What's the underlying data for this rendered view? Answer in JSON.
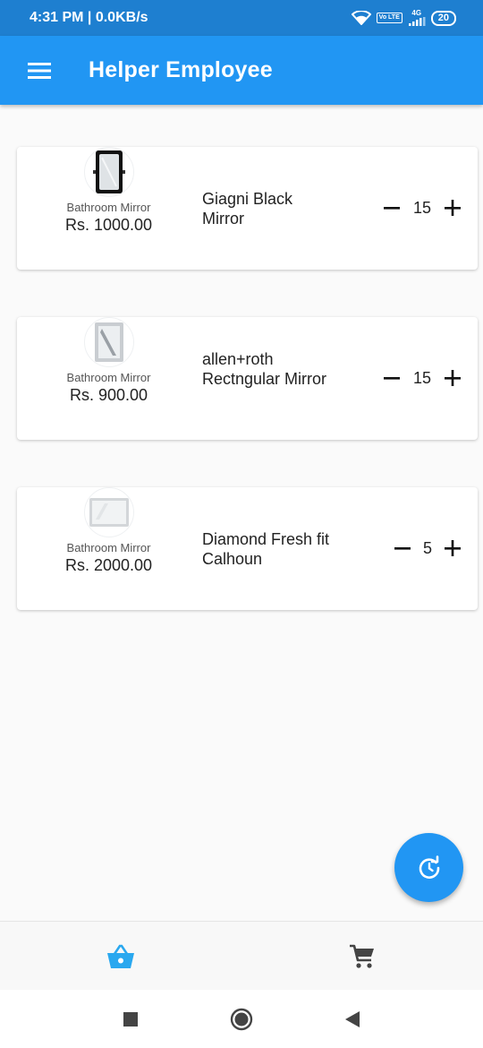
{
  "status_bar": {
    "time_speed": "4:31 PM | 0.0KB/s",
    "volte": "Vo LTE",
    "network": "4G",
    "battery": "20"
  },
  "app_bar": {
    "title": "Helper Employee",
    "menu_icon": "menu-icon"
  },
  "items": [
    {
      "category": "Bathroom Mirror",
      "price": "Rs. 1000.00",
      "name": "Giagni Black Mirror",
      "quantity": "15",
      "thumb": "black-framed-mirror"
    },
    {
      "category": "Bathroom Mirror",
      "price": "Rs. 900.00",
      "name": "allen+roth Rectngular Mirror",
      "quantity": "15",
      "thumb": "silver-rectangular-mirror"
    },
    {
      "category": "Bathroom Mirror",
      "price": "Rs. 2000.00",
      "name": "Diamond Fresh fit Calhoun",
      "quantity": "5",
      "thumb": "frameless-landscape-mirror"
    }
  ],
  "fab": {
    "icon": "history-refresh-icon"
  },
  "bottom_nav": [
    {
      "icon": "basket-icon",
      "active": true
    },
    {
      "icon": "cart-icon",
      "active": false
    }
  ],
  "colors": {
    "primary": "#2196f3",
    "status_bar": "#1e7fd0",
    "active_nav": "#2aa8ef",
    "inactive_nav": "#444444"
  }
}
